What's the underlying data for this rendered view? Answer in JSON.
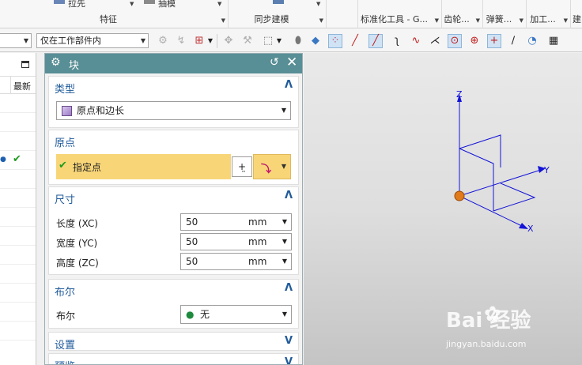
{
  "ribbon": {
    "groups": [
      {
        "id": "feature",
        "label": "特征"
      },
      {
        "id": "sync",
        "label": "同步建模"
      },
      {
        "id": "std",
        "label": "标准化工具 - G..."
      },
      {
        "id": "gear",
        "label": "齿轮..."
      },
      {
        "id": "spring",
        "label": "弹簧..."
      },
      {
        "id": "process",
        "label": "加工..."
      },
      {
        "id": "build",
        "label": "建"
      }
    ],
    "top_items": [
      "拉先",
      "抽模"
    ]
  },
  "toolbar": {
    "filter_value": "",
    "scope_value": "仅在工作部件内",
    "icons": [
      "select-feature-icon",
      "snap-icon",
      "select-box-icon",
      "move-icon",
      "component-icon",
      "rectangle-select-icon",
      "shaded-view-icon",
      "cube-view-icon",
      "snap-points-icon",
      "line-icon",
      "line-snap-icon",
      "curve-icon",
      "spline-icon",
      "intersection-icon",
      "center-point-icon",
      "quadrant-icon",
      "cross-point-icon",
      "slash-icon",
      "view-triad-icon",
      "layer-icon"
    ]
  },
  "nav": {
    "column_header": "最新"
  },
  "dialog": {
    "title": "块",
    "sections": {
      "type": {
        "title": "类型",
        "value": "原点和边长"
      },
      "origin": {
        "title": "原点",
        "point_label": "指定点"
      },
      "dimensions": {
        "title": "尺寸",
        "fields": [
          {
            "label": "长度 (XC)",
            "value": "50",
            "unit": "mm"
          },
          {
            "label": "宽度 (YC)",
            "value": "50",
            "unit": "mm"
          },
          {
            "label": "高度 (ZC)",
            "value": "50",
            "unit": "mm"
          }
        ]
      },
      "boolean": {
        "title": "布尔",
        "label": "布尔",
        "value": "无"
      },
      "settings": {
        "title": "设置"
      },
      "preview": {
        "title": "预览"
      }
    }
  },
  "viewport": {
    "axes": {
      "x": "X",
      "y": "Y",
      "z": "Z"
    },
    "axis_color": "#1414d8",
    "origin_color": "#e07a1a"
  },
  "watermark": {
    "brand": "Bai  经验",
    "url": "jingyan.baidu.com"
  }
}
